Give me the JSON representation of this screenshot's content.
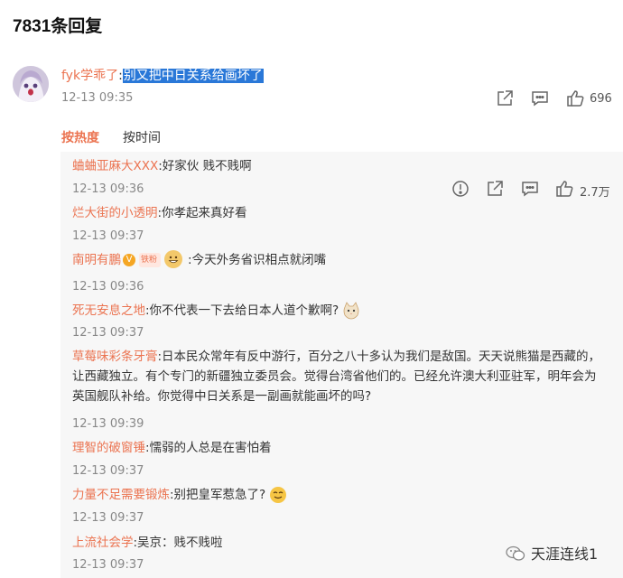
{
  "header": {
    "title": "7831条回复"
  },
  "main_comment": {
    "username": "fyk学乖了",
    "separator": ":",
    "text": "别又把中日关系给画坏了",
    "time": "12-13 09:35",
    "likes": "696"
  },
  "sort_tabs": {
    "hot": "按热度",
    "time": "按时间"
  },
  "replies": [
    {
      "username": "蛐蛐亚麻大XXX",
      "text": ":好家伙 贱不贱啊",
      "time": "12-13 09:36",
      "likes": "2.7万"
    },
    {
      "username": "烂大街的小透明",
      "text": ":你孝起来真好看",
      "time": "12-13 09:37"
    },
    {
      "username": "南明有鵬",
      "fan_badge": "铁粉",
      "text": ":今天外务省识相点就闭嘴",
      "time": "12-13 09:36"
    },
    {
      "username": "死无安息之地",
      "text": ":你不代表一下去给日本人道个歉啊?",
      "time": "12-13 09:37"
    },
    {
      "username": "草莓味彩条牙膏",
      "text": ":日本民众常年有反中游行，百分之八十多认为我们是敌国。天天说熊猫是西藏的，让西藏独立。有个专门的新疆独立委员会。觉得台湾省他们的。已经允许澳大利亚驻军，明年会为英国舰队补给。你觉得中日关系是一副画就能画坏的吗?",
      "time": "12-13 09:39"
    },
    {
      "username": "理智的破窗锤",
      "text": ":懦弱的人总是在害怕着",
      "time": "12-13 09:37"
    },
    {
      "username": "力量不足需要锻炼",
      "text": ":别把皇军惹急了?",
      "time": "12-13 09:37"
    },
    {
      "username": "上流社会学",
      "text": ":吴京：贱不贱啦",
      "time": "12-13 09:37"
    }
  ],
  "watermark": {
    "text": "天涯连线1"
  },
  "icons": [
    "share-icon",
    "comment-icon",
    "like-icon",
    "report-icon",
    "verified-icon",
    "emoji-cat-icon",
    "emoji-grin-icon",
    "wechat-icon"
  ],
  "colors": {
    "username": "#eb7350",
    "highlight": "#2a78d8",
    "panel": "#f7f7f7",
    "time": "#888888"
  }
}
